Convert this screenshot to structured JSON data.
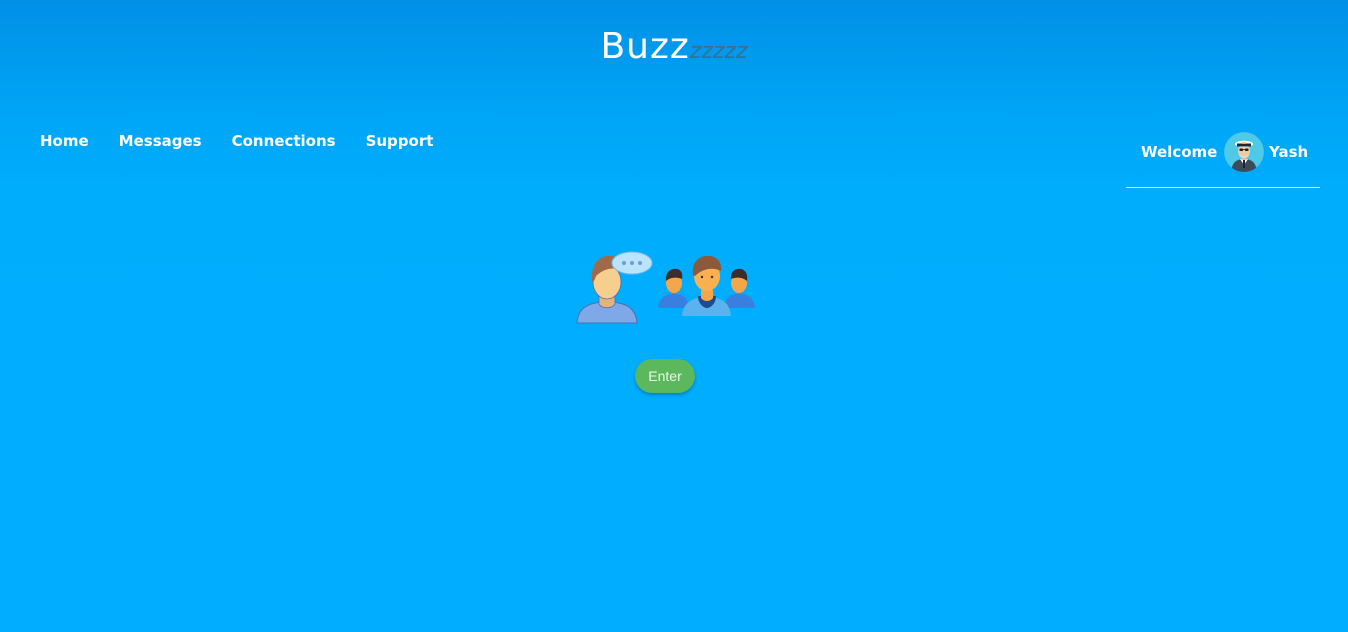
{
  "brand": {
    "name_main": "Buzz",
    "name_tail": "zzzzz"
  },
  "nav": {
    "items": [
      {
        "label": "Home"
      },
      {
        "label": "Messages"
      },
      {
        "label": "Connections"
      },
      {
        "label": "Support"
      }
    ]
  },
  "user": {
    "welcome_label": "Welcome",
    "name": "Yash",
    "avatar_icon": "captain-avatar-icon"
  },
  "main": {
    "illustration_icon": "chat-group-icon",
    "enter_label": "Enter"
  },
  "colors": {
    "background": "#00adff",
    "header_top": "#0090e8",
    "button": "#5cb85c",
    "logo_tail": "#3a6f8f"
  }
}
